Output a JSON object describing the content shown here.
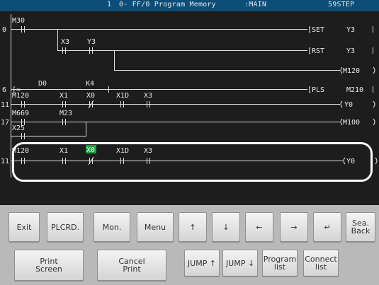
{
  "titlebar": {
    "index": "1",
    "title": "0- FF/0 Program Memory",
    "program": ":MAIN",
    "step": "59STEP"
  },
  "ladder": {
    "step_numbers": [
      "0",
      "6",
      "11",
      "17",
      "11"
    ],
    "rung0": {
      "contact_main": "M30",
      "contact_a": "X3",
      "contact_b": "Y3",
      "instr1": "SET",
      "dev1": "Y3",
      "instr2": "RST",
      "dev2": "Y3",
      "coil": "M120"
    },
    "rung6": {
      "cmp": "=",
      "op1": "D0",
      "op2": "K4",
      "instr": "PLS",
      "dev": "M210"
    },
    "rung11": {
      "c1": "M120",
      "c2": "X1",
      "c3": "X0",
      "c4": "X1D",
      "c5": "X3",
      "coil": "Y0"
    },
    "rung17": {
      "c1": "M669",
      "c2": "M23",
      "c3": "X25",
      "coil": "M100"
    },
    "rung_sel": {
      "c1": "M120",
      "c2": "X1",
      "c3": "X0",
      "c4": "X1D",
      "c5": "X3",
      "coil": "Y0"
    }
  },
  "buttons_row1": [
    "Exit",
    "PLCRD.",
    "Mon.",
    "Menu",
    "↑",
    "↓",
    "←",
    "→",
    "↵",
    "Sea.\nBack"
  ],
  "buttons_row2": [
    "Print\nScreen",
    "Cancel\nPrint",
    "JUMP ↑",
    "JUMP ↓",
    "Program\nlist",
    "Connect\nlist"
  ],
  "colors": {
    "titlebar": "#0c4e78",
    "screen_bg": "#1d1d1d",
    "line": "#e0e0e0",
    "cursor": "#1ea03c",
    "panel": "#b9b9b9"
  }
}
